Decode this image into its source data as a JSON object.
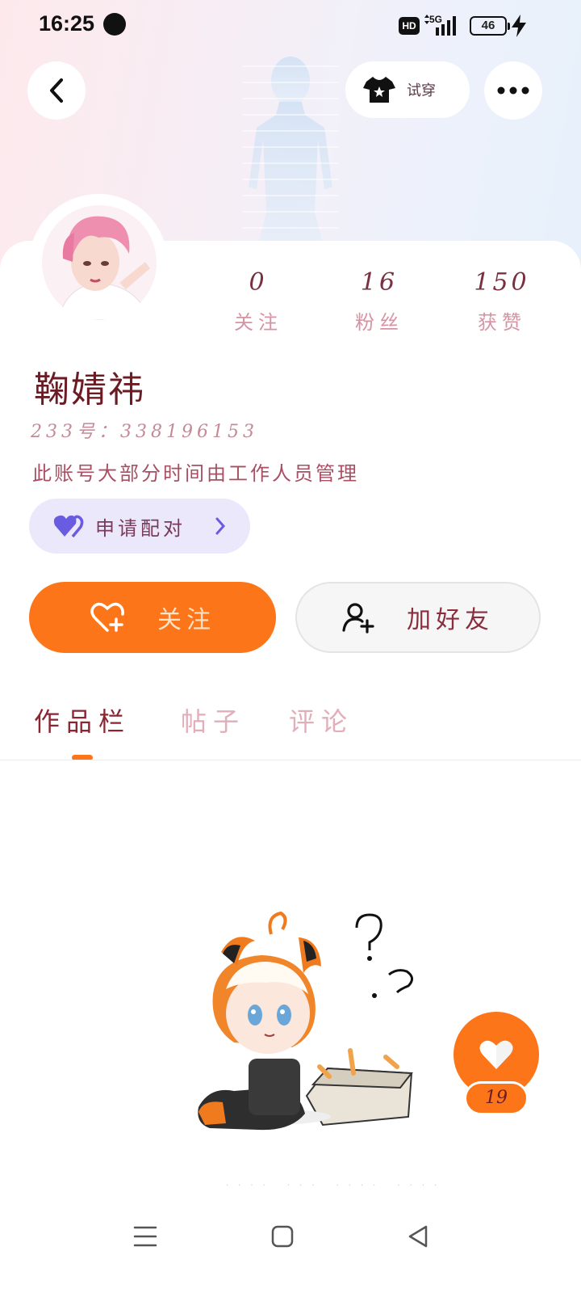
{
  "status_bar": {
    "time": "16:25",
    "hd": "HD",
    "network": "5G",
    "battery": "46"
  },
  "header": {
    "try_on_label": "试穿"
  },
  "profile": {
    "stats": [
      {
        "value": "0",
        "label": "关注"
      },
      {
        "value": "16",
        "label": "粉丝"
      },
      {
        "value": "150",
        "label": "获赞"
      }
    ],
    "name": "鞠婧祎",
    "id_line": "233号：338196153",
    "bio": "此账号大部分时间由工作人员管理",
    "pair_label": "申请配对"
  },
  "actions": {
    "follow_label": "关注",
    "add_friend_label": "加好友"
  },
  "tabs": [
    {
      "label": "作品栏",
      "active": true
    },
    {
      "label": "帖子",
      "active": false
    },
    {
      "label": "评论",
      "active": false
    }
  ],
  "like_count": "19",
  "colors": {
    "accent": "#fc7518",
    "pair_bg": "#ebe8fb",
    "heart_purple": "#6a5ce0"
  },
  "icons": [
    "back-icon",
    "tshirt-icon",
    "more-icon",
    "heart-pair-icon",
    "chevron-right-icon",
    "heart-plus-icon",
    "add-user-icon",
    "heart-icon",
    "menu-icon",
    "home-square-icon",
    "back-triangle-icon"
  ]
}
